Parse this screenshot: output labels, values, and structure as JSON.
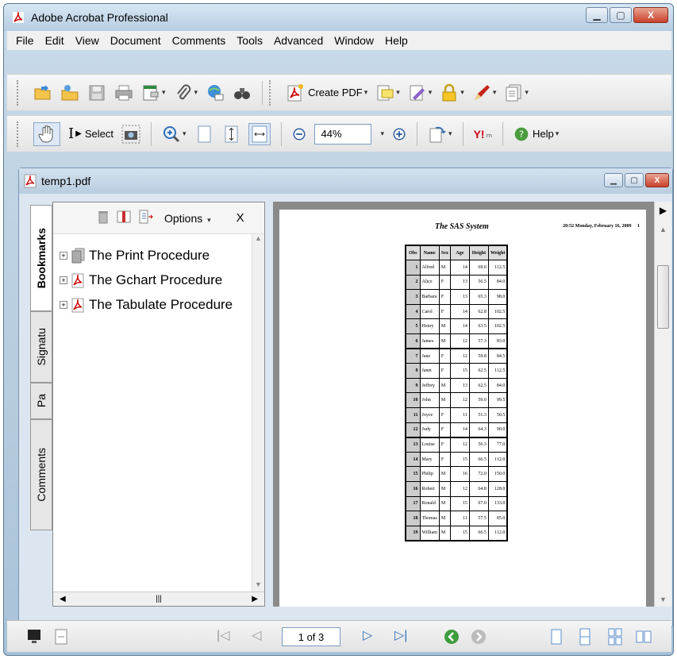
{
  "window": {
    "title": "Adobe Acrobat Professional"
  },
  "menu": [
    "File",
    "Edit",
    "View",
    "Document",
    "Comments",
    "Tools",
    "Advanced",
    "Window",
    "Help"
  ],
  "toolbar1": {
    "create_pdf_label": "Create PDF"
  },
  "toolbar2": {
    "select_label": "Select",
    "zoom_value": "44%",
    "help_label": "Help"
  },
  "doc": {
    "title": "temp1.pdf"
  },
  "side_tabs": [
    "Bookmarks",
    "Signatu",
    "Pa",
    "Comments"
  ],
  "bookmarks_panel": {
    "options_label": "Options",
    "close_label": "X",
    "items": [
      {
        "label": "The Print Procedure"
      },
      {
        "label": "The Gchart Procedure"
      },
      {
        "label": "The Tabulate Procedure"
      }
    ]
  },
  "page": {
    "title": "The SAS System",
    "date": "20:52 Monday, February 16, 2009",
    "page_number": "1",
    "columns": [
      "Obs",
      "Name",
      "Sex",
      "Age",
      "Height",
      "Weight"
    ],
    "rows": [
      [
        "1",
        "Alfred",
        "M",
        "14",
        "69.0",
        "112.5"
      ],
      [
        "2",
        "Alice",
        "F",
        "13",
        "56.5",
        "84.0"
      ],
      [
        "3",
        "Barbara",
        "F",
        "13",
        "65.3",
        "98.0"
      ],
      [
        "4",
        "Carol",
        "F",
        "14",
        "62.8",
        "102.5"
      ],
      [
        "5",
        "Henry",
        "M",
        "14",
        "63.5",
        "102.5"
      ],
      [
        "6",
        "James",
        "M",
        "12",
        "57.3",
        "83.0"
      ],
      [
        "7",
        "Jane",
        "F",
        "12",
        "59.8",
        "84.5"
      ],
      [
        "8",
        "Janet",
        "F",
        "15",
        "62.5",
        "112.5"
      ],
      [
        "9",
        "Jeffrey",
        "M",
        "13",
        "62.5",
        "84.0"
      ],
      [
        "10",
        "John",
        "M",
        "12",
        "59.0",
        "99.5"
      ],
      [
        "11",
        "Joyce",
        "F",
        "11",
        "51.3",
        "50.5"
      ],
      [
        "12",
        "Judy",
        "F",
        "14",
        "64.3",
        "90.0"
      ],
      [
        "13",
        "Louise",
        "F",
        "12",
        "56.3",
        "77.0"
      ],
      [
        "14",
        "Mary",
        "F",
        "15",
        "66.5",
        "112.0"
      ],
      [
        "15",
        "Philip",
        "M",
        "16",
        "72.0",
        "150.0"
      ],
      [
        "16",
        "Robert",
        "M",
        "12",
        "64.8",
        "128.0"
      ],
      [
        "17",
        "Ronald",
        "M",
        "15",
        "67.0",
        "133.0"
      ],
      [
        "18",
        "Thomas",
        "M",
        "11",
        "57.5",
        "85.0"
      ],
      [
        "19",
        "William",
        "M",
        "15",
        "66.5",
        "112.0"
      ]
    ]
  },
  "statusbar": {
    "page_indicator": "1 of 3"
  }
}
